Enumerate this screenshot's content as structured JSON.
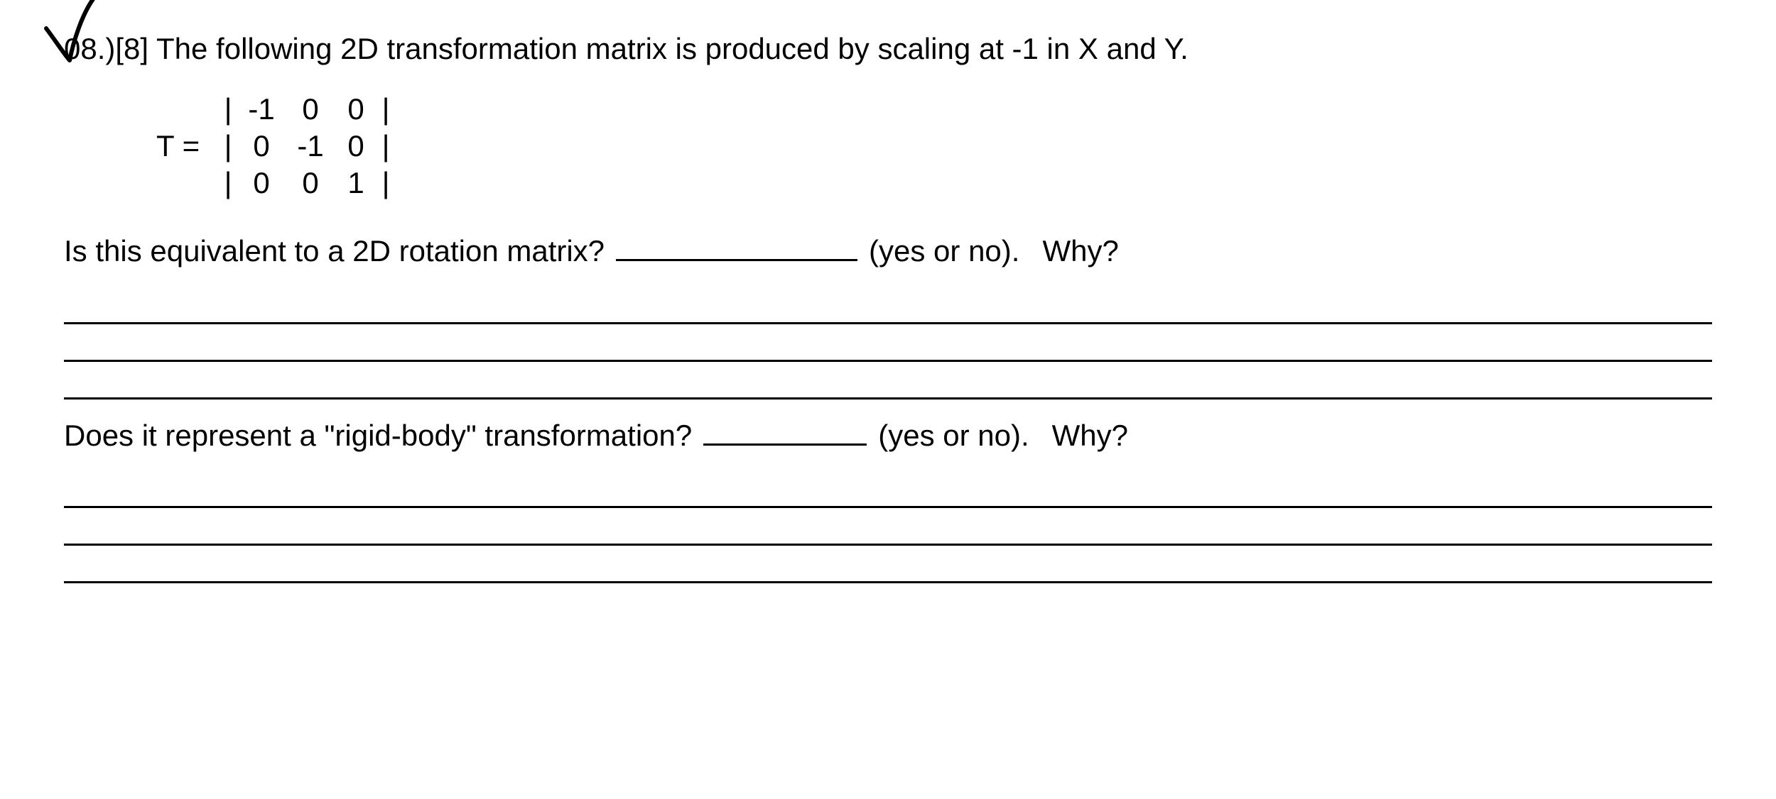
{
  "question": {
    "number_label": "08.)[8]",
    "prompt": "The following 2D transformation matrix is produced by scaling at -1 in X and Y."
  },
  "matrix": {
    "label": "T =",
    "rows": [
      [
        "-1",
        "0",
        "0"
      ],
      [
        "0",
        "-1",
        "0"
      ],
      [
        "0",
        "0",
        "1"
      ]
    ],
    "bar": "|"
  },
  "sub1": {
    "text_before": "Is this equivalent to a 2D rotation matrix?",
    "hint": "(yes or no).",
    "why": "Why?"
  },
  "sub2": {
    "text_before": "Does it represent a \"rigid-body\" transformation?",
    "hint": "(yes or no).",
    "why": "Why?"
  }
}
